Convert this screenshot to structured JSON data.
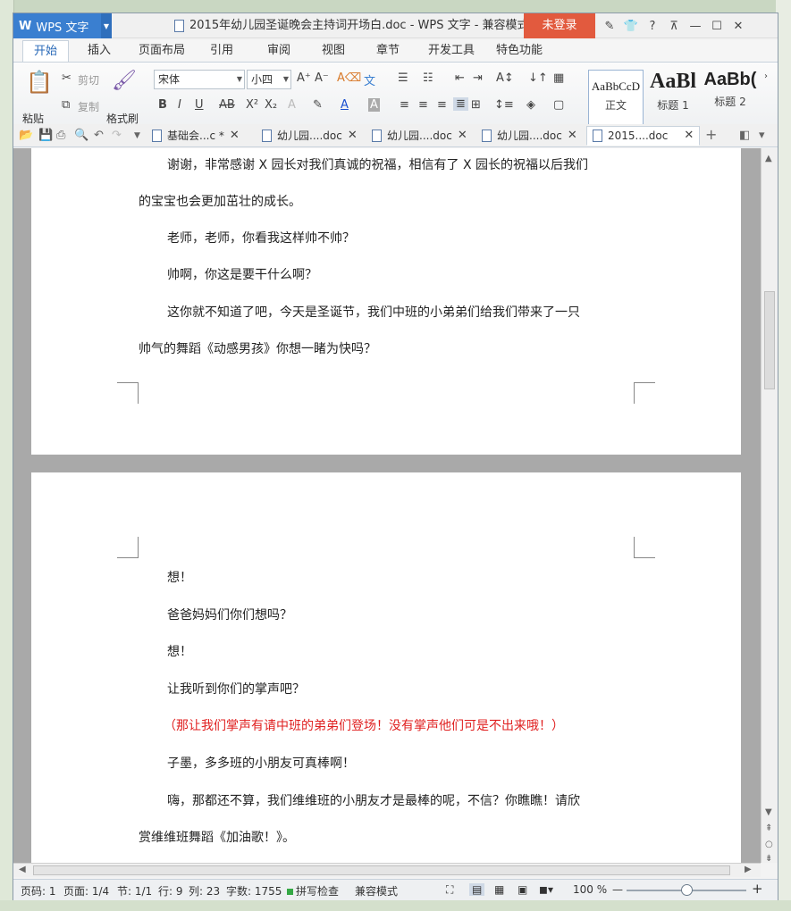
{
  "window": {
    "app_button": "WPS 文字",
    "title": "2015年幼儿园圣诞晚会主持词开场白.doc - WPS 文字 - 兼容模式",
    "login": "未登录",
    "controls": [
      "✎",
      "👕",
      "?",
      "⊼",
      "—",
      "☐",
      "✕"
    ]
  },
  "menu": {
    "tabs": [
      "开始",
      "插入",
      "页面布局",
      "引用",
      "审阅",
      "视图",
      "章节",
      "开发工具",
      "特色功能"
    ],
    "active": "开始"
  },
  "ribbon": {
    "paste": "粘贴",
    "cut": "剪切",
    "copy": "复制",
    "format_painter": "格式刷",
    "font_name": "宋体",
    "font_size": "小四",
    "styles": [
      {
        "preview": "AaBbCcD",
        "name": "正文"
      },
      {
        "preview": "AaBl",
        "name": "标题 1"
      },
      {
        "preview": "AaBb(",
        "name": "标题 2"
      }
    ]
  },
  "doc_tabs": [
    {
      "label": "基础会...c *",
      "active": false
    },
    {
      "label": "幼儿园....doc",
      "active": false
    },
    {
      "label": "幼儿园....doc",
      "active": false
    },
    {
      "label": "幼儿园....doc",
      "active": false
    },
    {
      "label": "2015....doc",
      "active": true
    }
  ],
  "page1": {
    "lines": [
      "谢谢，非常感谢 X 园长对我们真诚的祝福，相信有了 X 园长的祝福以后我们",
      "的宝宝也会更加茁壮的成长。",
      "老师，老师，你看我这样帅不帅？",
      "帅啊，你这是要干什么啊？",
      "这你就不知道了吧，今天是圣诞节，我们中班的小弟弟们给我们带来了一只",
      "帅气的舞蹈《动感男孩》你想一睹为快吗？"
    ]
  },
  "page2": {
    "lines": [
      "想！",
      "爸爸妈妈们你们想吗？",
      "想！",
      "让我听到你们的掌声吧？",
      "（那让我们掌声有请中班的弟弟们登场！没有掌声他们可是不出来哦！）",
      "子墨，多多班的小朋友可真棒啊！",
      "嗨，那都还不算，我们维维班的小朋友才是最棒的呢，不信？你瞧瞧！请欣",
      "赏维维班舞蹈《加油歌！》。"
    ],
    "highlight_color": "#e02020"
  },
  "status": {
    "page_no": "页码: 1",
    "pages": "页面: 1/4",
    "section": "节: 1/1",
    "row": "行: 9",
    "col": "列: 23",
    "words": "字数: 1755",
    "spell": "拼写检查",
    "mode": "兼容模式",
    "zoom": "100 %",
    "zoom_percent": 100
  },
  "colors": {
    "accent": "#3a7fd0",
    "login": "#e25a3e"
  }
}
